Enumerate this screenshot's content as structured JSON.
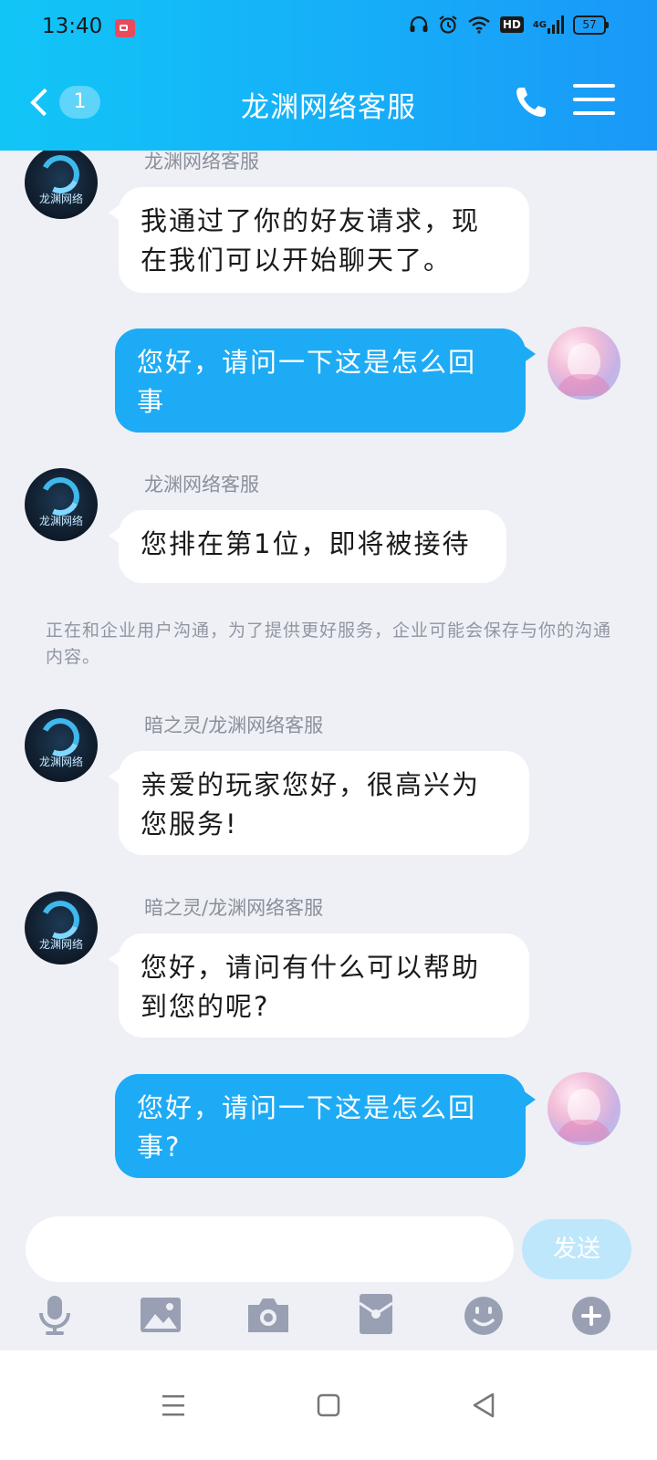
{
  "status_bar": {
    "time": "13:40",
    "network": "4G",
    "hd": "HD",
    "battery": "57",
    "icons": [
      "screen-record-icon",
      "headphones-icon",
      "alarm-icon",
      "wifi-icon",
      "hd-icon",
      "signal-icon",
      "battery-icon"
    ]
  },
  "header": {
    "unread_count": "1",
    "title": "龙渊网络客服",
    "icons": [
      "back-chevron-icon",
      "phone-icon",
      "menu-icon"
    ]
  },
  "messages": [
    {
      "direction": "in",
      "sender": "龙渊网络客服",
      "text": "我通过了你的好友请求，现在我们可以开始聊天了。"
    },
    {
      "direction": "out",
      "sender": "",
      "text": "您好，请问一下这是怎么回事"
    },
    {
      "direction": "in",
      "sender": "龙渊网络客服",
      "text": "您排在第1位，即将被接待"
    },
    {
      "direction": "in",
      "sender": "暗之灵/龙渊网络客服",
      "text": "亲爱的玩家您好，很高兴为您服务!"
    },
    {
      "direction": "in",
      "sender": "暗之灵/龙渊网络客服",
      "text": "您好，请问有什么可以帮助到您的呢?"
    },
    {
      "direction": "out",
      "sender": "",
      "text": "您好，请问一下这是怎么回事?"
    }
  ],
  "system_note": "正在和企业用户沟通，为了提供更好服务，企业可能会保存与你的沟通内容。",
  "avatar_logo_text": "龙渊网络",
  "composer": {
    "input_value": "",
    "send_label": "发送"
  },
  "toolbar_icons": [
    "microphone-icon",
    "image-icon",
    "camera-icon",
    "red-packet-icon",
    "emoji-icon",
    "plus-icon"
  ],
  "nav_icons": [
    "recent-apps-icon",
    "home-icon",
    "back-icon"
  ],
  "colors": {
    "header_gradient_start": "#11c6f7",
    "header_gradient_end": "#1a98f8",
    "outgoing_bubble": "#1eabf5",
    "incoming_bubble": "#ffffff",
    "chat_background": "#eef0f6",
    "send_button_disabled": "#bfe7fb",
    "toolbar_icon": "#9aa0b3"
  }
}
